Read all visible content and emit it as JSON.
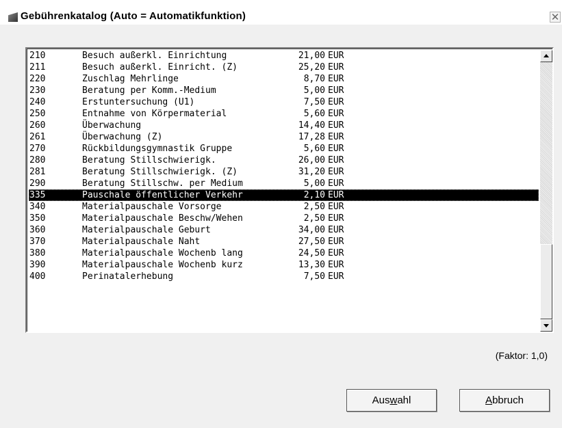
{
  "window": {
    "title": "Gebührenkatalog (Auto = Automatikfunktion)",
    "close_glyph": "✕"
  },
  "list": {
    "rows": [
      {
        "code": "210",
        "desc": "Besuch außerkl. Einrichtung",
        "amount": "21,00",
        "currency": "EUR"
      },
      {
        "code": "211",
        "desc": "Besuch außerkl. Einricht. (Z)",
        "amount": "25,20",
        "currency": "EUR"
      },
      {
        "code": "220",
        "desc": "Zuschlag Mehrlinge",
        "amount": "8,70",
        "currency": "EUR"
      },
      {
        "code": "230",
        "desc": "Beratung per Komm.-Medium",
        "amount": "5,00",
        "currency": "EUR"
      },
      {
        "code": "240",
        "desc": "Erstuntersuchung (U1)",
        "amount": "7,50",
        "currency": "EUR"
      },
      {
        "code": "250",
        "desc": "Entnahme von Körpermaterial",
        "amount": "5,60",
        "currency": "EUR"
      },
      {
        "code": "260",
        "desc": "Überwachung",
        "amount": "14,40",
        "currency": "EUR"
      },
      {
        "code": "261",
        "desc": "Überwachung (Z)",
        "amount": "17,28",
        "currency": "EUR"
      },
      {
        "code": "270",
        "desc": "Rückbildungsgymnastik Gruppe",
        "amount": "5,60",
        "currency": "EUR"
      },
      {
        "code": "280",
        "desc": "Beratung Stillschwierigk.",
        "amount": "26,00",
        "currency": "EUR"
      },
      {
        "code": "281",
        "desc": "Beratung Stillschwierigk. (Z)",
        "amount": "31,20",
        "currency": "EUR"
      },
      {
        "code": "290",
        "desc": "Beratung Stillschw. per Medium",
        "amount": "5,00",
        "currency": "EUR"
      },
      {
        "code": "335",
        "desc": "Pauschale öffentlicher Verkehr",
        "amount": "2,10",
        "currency": "EUR",
        "selected": true
      },
      {
        "code": "340",
        "desc": "Materialpauschale Vorsorge",
        "amount": "2,50",
        "currency": "EUR"
      },
      {
        "code": "350",
        "desc": "Materialpauschale Beschw/Wehen",
        "amount": "2,50",
        "currency": "EUR"
      },
      {
        "code": "360",
        "desc": "Materialpauschale Geburt",
        "amount": "34,00",
        "currency": "EUR"
      },
      {
        "code": "370",
        "desc": "Materialpauschale Naht",
        "amount": "27,50",
        "currency": "EUR"
      },
      {
        "code": "380",
        "desc": "Materialpauschale Wochenb lang",
        "amount": "24,50",
        "currency": "EUR"
      },
      {
        "code": "390",
        "desc": "Materialpauschale Wochenb kurz",
        "amount": "13,30",
        "currency": "EUR"
      },
      {
        "code": "400",
        "desc": "Perinatalerhebung",
        "amount": "7,50",
        "currency": "EUR"
      }
    ]
  },
  "factor_label": "(Faktor: 1,0)",
  "buttons": {
    "select": {
      "pre": "Aus",
      "accel": "w",
      "post": "ahl"
    },
    "cancel": {
      "pre": "",
      "accel": "A",
      "post": "bbruch"
    }
  }
}
